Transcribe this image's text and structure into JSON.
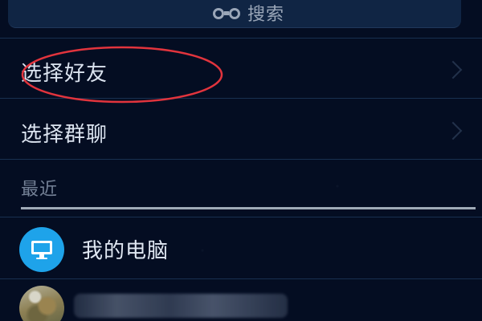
{
  "search": {
    "label": "搜索",
    "icon": "binoculars-icon"
  },
  "menu": {
    "items": [
      {
        "label": "选择好友",
        "icon": "chevron-right-icon"
      },
      {
        "label": "选择群聊",
        "icon": "chevron-right-icon"
      }
    ]
  },
  "recent": {
    "title": "最近",
    "items": [
      {
        "name": "我的电脑",
        "icon": "computer-icon",
        "accent": "#1ea3ea"
      },
      {
        "name": "",
        "icon": "photo-avatar"
      }
    ]
  },
  "colors": {
    "background": "#040d22",
    "search_bar": "#102544",
    "annotation": "#e2343d",
    "accent": "#1ea3ea"
  }
}
